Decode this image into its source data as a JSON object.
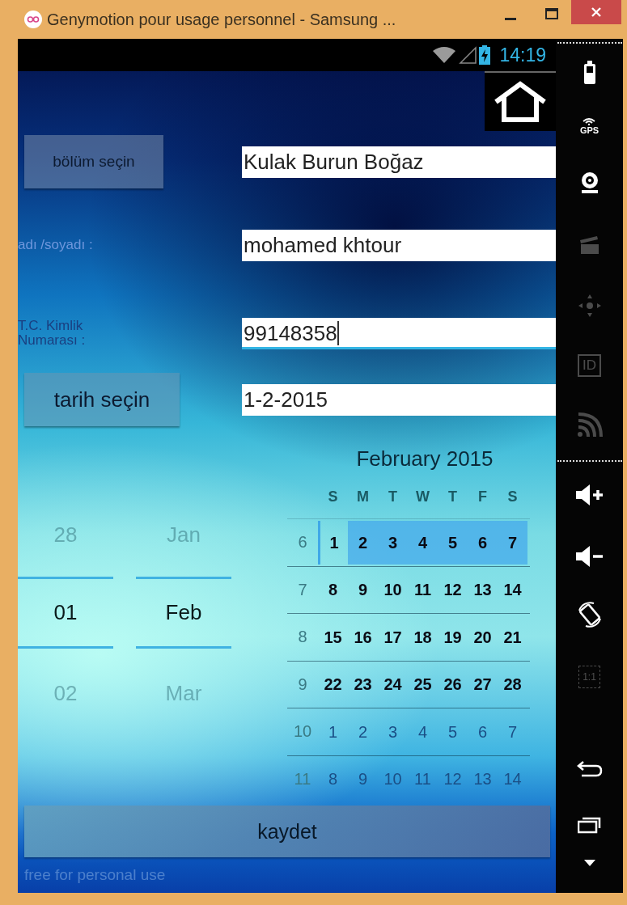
{
  "window": {
    "title": "Genymotion pour usage personnel - Samsung ..."
  },
  "status_bar": {
    "time": "14:19"
  },
  "form": {
    "rows": [
      {
        "kind": "button",
        "label": "bölüm seçin",
        "value": "Kulak Burun Boğaz",
        "focused": false
      },
      {
        "kind": "label",
        "label": "adı /soyadı :",
        "value": "mohamed khtour",
        "focused": false
      },
      {
        "kind": "label",
        "label": "T.C. Kimlik Numarası :",
        "value": "99148358",
        "focused": true
      },
      {
        "kind": "button",
        "label": "tarih seçin",
        "value": "1-2-2015",
        "focused": false
      }
    ]
  },
  "date_picker": {
    "columns": [
      {
        "items": [
          {
            "label": "28",
            "selected": false
          },
          {
            "label": "01",
            "selected": true
          },
          {
            "label": "02",
            "selected": false
          }
        ]
      },
      {
        "items": [
          {
            "label": "Jan",
            "selected": false
          },
          {
            "label": "Feb",
            "selected": true
          },
          {
            "label": "Mar",
            "selected": false
          }
        ]
      }
    ]
  },
  "calendar": {
    "title": "February 2015",
    "weekdays": [
      "S",
      "M",
      "T",
      "W",
      "T",
      "F",
      "S"
    ],
    "weeks": [
      {
        "number": "6",
        "selected": true,
        "days": [
          {
            "label": "1",
            "in_month": true,
            "selected": true
          },
          {
            "label": "2",
            "in_month": true,
            "selected": false
          },
          {
            "label": "3",
            "in_month": true,
            "selected": false
          },
          {
            "label": "4",
            "in_month": true,
            "selected": false
          },
          {
            "label": "5",
            "in_month": true,
            "selected": false
          },
          {
            "label": "6",
            "in_month": true,
            "selected": false
          },
          {
            "label": "7",
            "in_month": true,
            "selected": false
          }
        ]
      },
      {
        "number": "7",
        "selected": false,
        "days": [
          {
            "label": "8",
            "in_month": true,
            "selected": false
          },
          {
            "label": "9",
            "in_month": true,
            "selected": false
          },
          {
            "label": "10",
            "in_month": true,
            "selected": false
          },
          {
            "label": "11",
            "in_month": true,
            "selected": false
          },
          {
            "label": "12",
            "in_month": true,
            "selected": false
          },
          {
            "label": "13",
            "in_month": true,
            "selected": false
          },
          {
            "label": "14",
            "in_month": true,
            "selected": false
          }
        ]
      },
      {
        "number": "8",
        "selected": false,
        "days": [
          {
            "label": "15",
            "in_month": true,
            "selected": false
          },
          {
            "label": "16",
            "in_month": true,
            "selected": false
          },
          {
            "label": "17",
            "in_month": true,
            "selected": false
          },
          {
            "label": "18",
            "in_month": true,
            "selected": false
          },
          {
            "label": "19",
            "in_month": true,
            "selected": false
          },
          {
            "label": "20",
            "in_month": true,
            "selected": false
          },
          {
            "label": "21",
            "in_month": true,
            "selected": false
          }
        ]
      },
      {
        "number": "9",
        "selected": false,
        "days": [
          {
            "label": "22",
            "in_month": true,
            "selected": false
          },
          {
            "label": "23",
            "in_month": true,
            "selected": false
          },
          {
            "label": "24",
            "in_month": true,
            "selected": false
          },
          {
            "label": "25",
            "in_month": true,
            "selected": false
          },
          {
            "label": "26",
            "in_month": true,
            "selected": false
          },
          {
            "label": "27",
            "in_month": true,
            "selected": false
          },
          {
            "label": "28",
            "in_month": true,
            "selected": false
          }
        ]
      },
      {
        "number": "10",
        "selected": false,
        "days": [
          {
            "label": "1",
            "in_month": false,
            "selected": false
          },
          {
            "label": "2",
            "in_month": false,
            "selected": false
          },
          {
            "label": "3",
            "in_month": false,
            "selected": false
          },
          {
            "label": "4",
            "in_month": false,
            "selected": false
          },
          {
            "label": "5",
            "in_month": false,
            "selected": false
          },
          {
            "label": "6",
            "in_month": false,
            "selected": false
          },
          {
            "label": "7",
            "in_month": false,
            "selected": false
          }
        ]
      },
      {
        "number": "11",
        "selected": false,
        "days": [
          {
            "label": "8",
            "in_month": false,
            "selected": false
          },
          {
            "label": "9",
            "in_month": false,
            "selected": false
          },
          {
            "label": "10",
            "in_month": false,
            "selected": false
          },
          {
            "label": "11",
            "in_month": false,
            "selected": false
          },
          {
            "label": "12",
            "in_month": false,
            "selected": false
          },
          {
            "label": "13",
            "in_month": false,
            "selected": false
          },
          {
            "label": "14",
            "in_month": false,
            "selected": false
          }
        ]
      }
    ]
  },
  "save_button": "kaydet",
  "footer_note": "free for personal use",
  "sidebar": {
    "tools": [
      {
        "kind": "battery",
        "disabled": false
      },
      {
        "kind": "gps",
        "label": "GPS",
        "disabled": false
      },
      {
        "kind": "webcam",
        "disabled": false
      },
      {
        "kind": "clapperboard",
        "disabled": true
      },
      {
        "kind": "dpad",
        "disabled": true
      },
      {
        "kind": "id",
        "label": "ID",
        "disabled": true
      },
      {
        "kind": "rss",
        "disabled": true
      },
      {
        "kind": "separator"
      },
      {
        "kind": "volume_up",
        "disabled": false
      },
      {
        "kind": "volume_down",
        "disabled": false
      },
      {
        "kind": "rotate",
        "disabled": false
      },
      {
        "kind": "scale",
        "label": "1:1",
        "disabled": true
      },
      {
        "kind": "spacer"
      },
      {
        "kind": "back",
        "disabled": false
      },
      {
        "kind": "recent",
        "disabled": false
      },
      {
        "kind": "more",
        "disabled": false
      }
    ]
  }
}
